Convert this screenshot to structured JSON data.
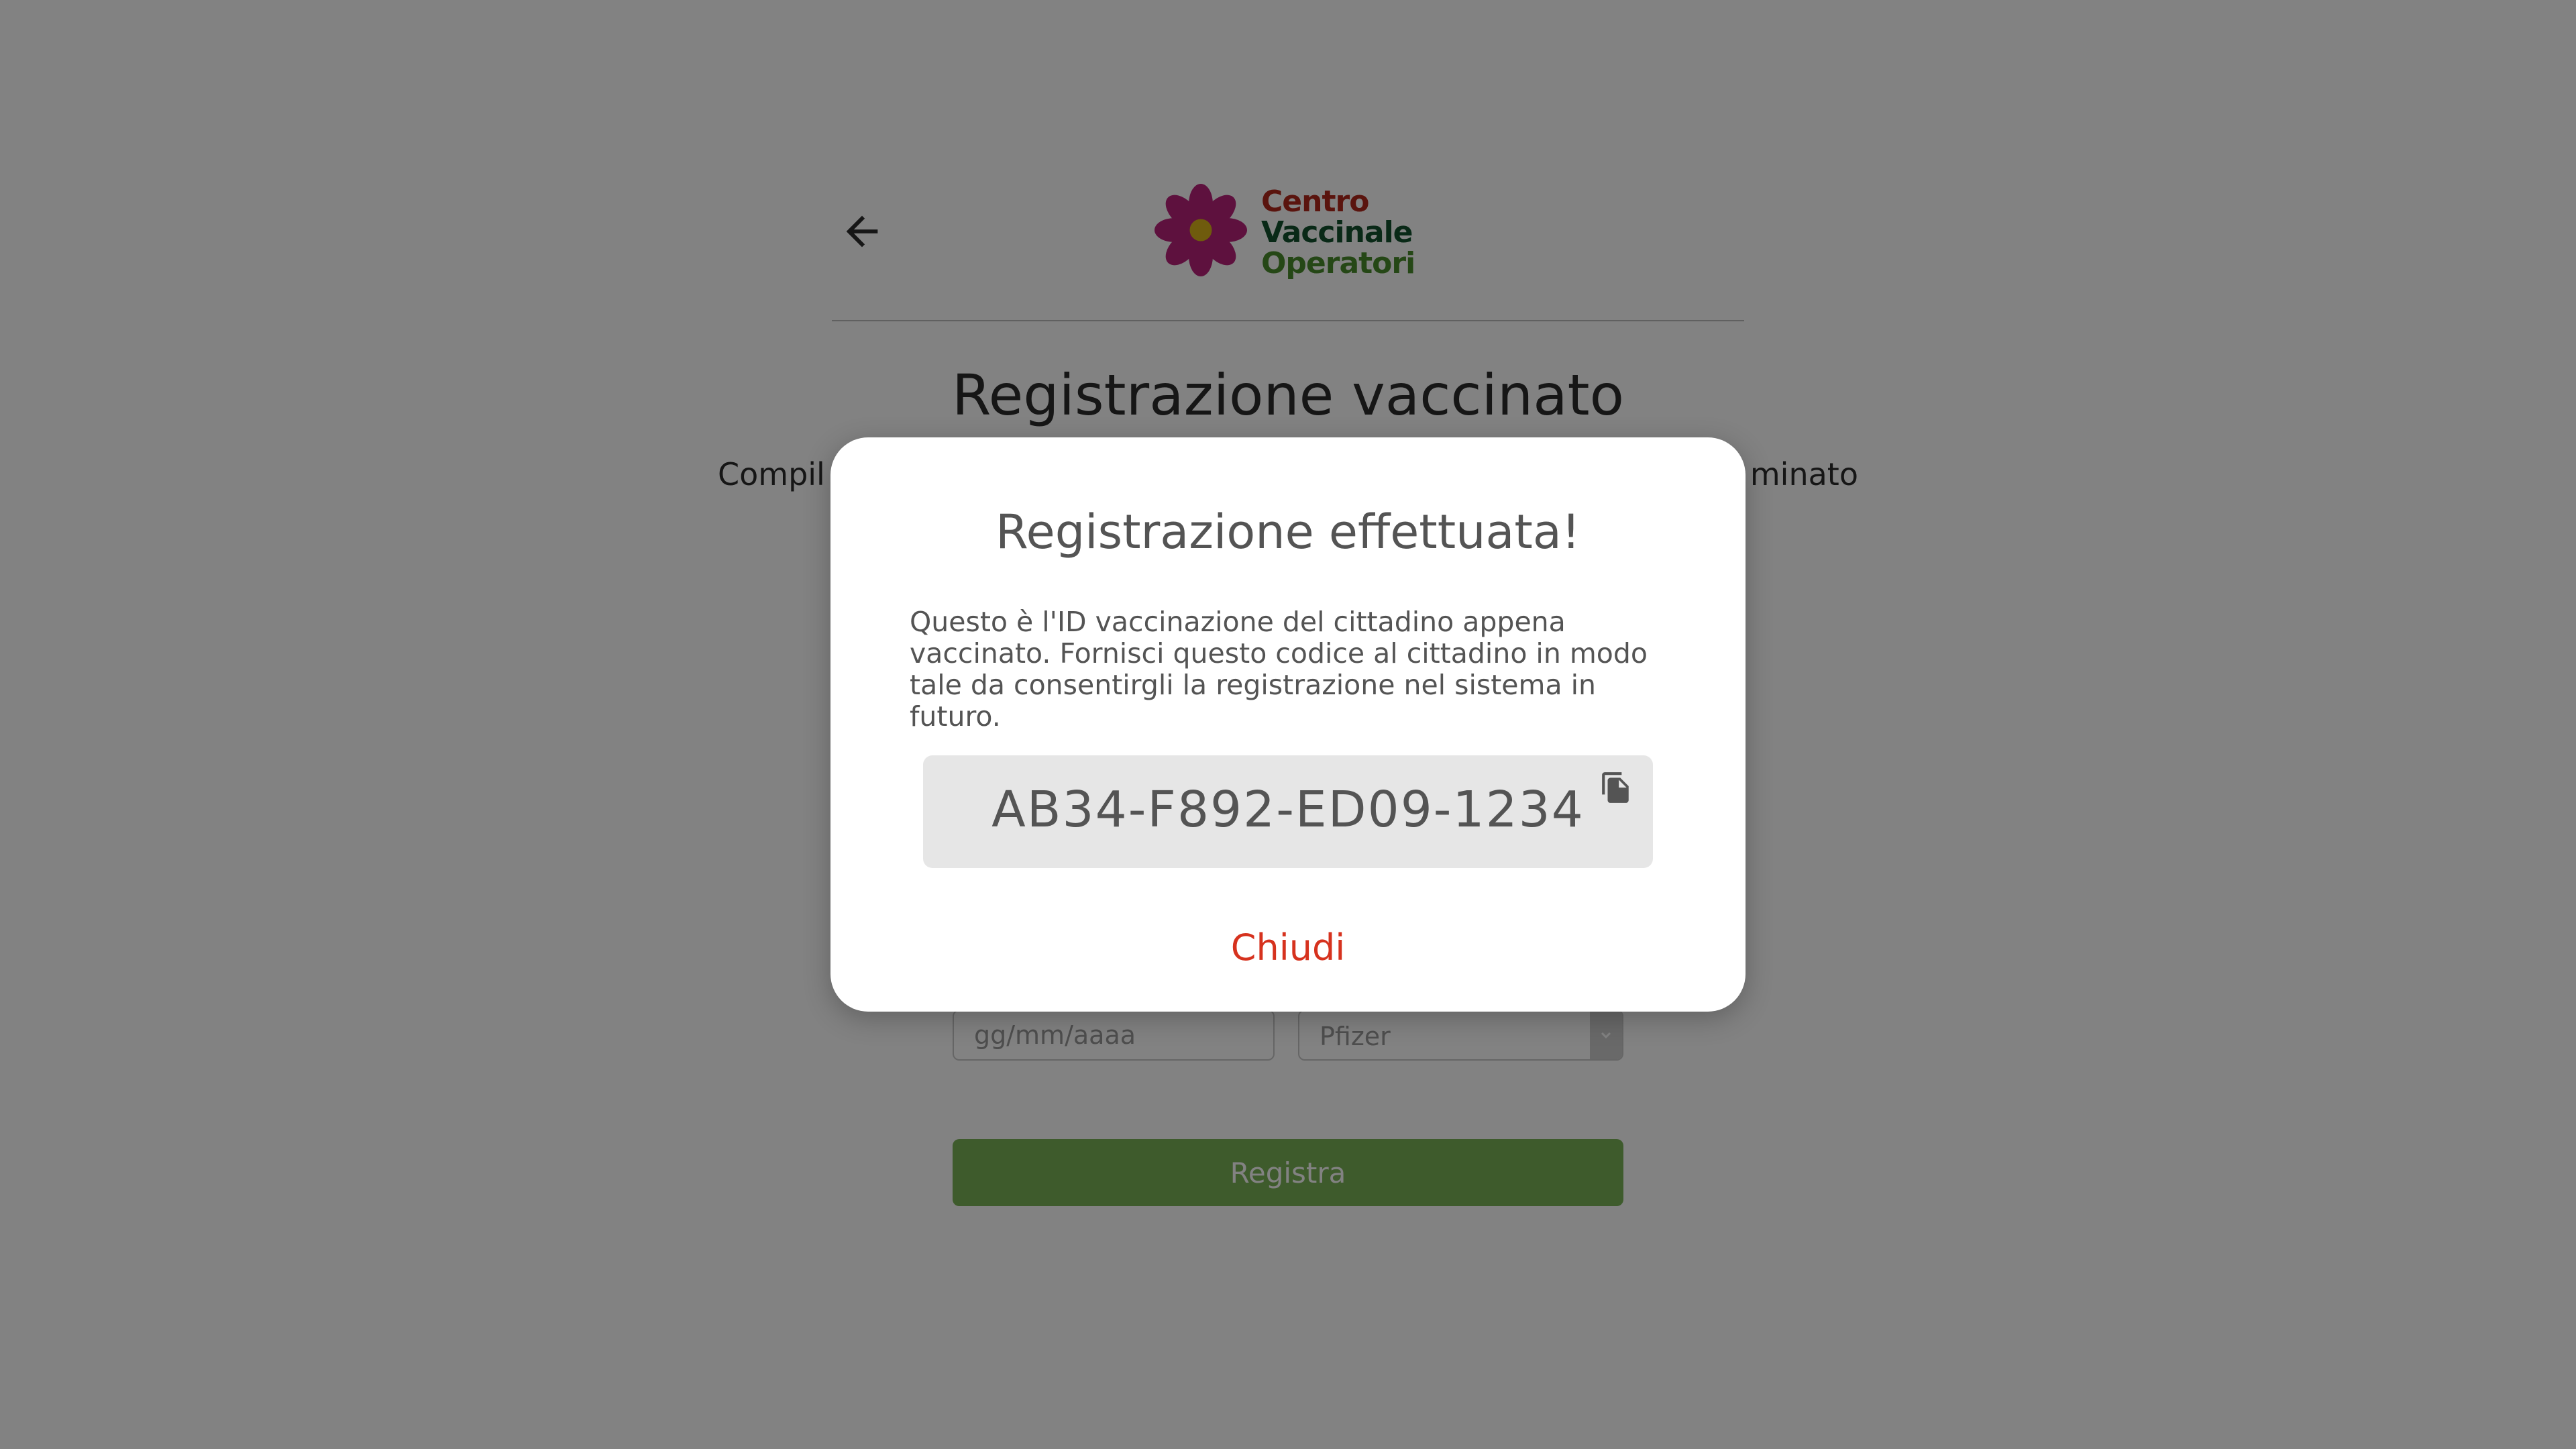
{
  "header": {
    "back_icon": "arrow-left-icon",
    "logo": {
      "line1": "Centro",
      "line2": "Vaccinale",
      "line3": "Operatori",
      "colors": {
        "line1": "#b0281c",
        "line2": "#13522d",
        "line3": "#4a8b2c",
        "petals": "#b8237a",
        "center": "#d9b21b"
      }
    }
  },
  "page": {
    "title": "Registrazione vaccinato",
    "subtitle_left": "Compil",
    "subtitle_right": "minato"
  },
  "form": {
    "date_placeholder": "gg/mm/aaaa",
    "vaccine_value": "Pfizer",
    "register_label": "Registra",
    "accent_color": "#7ab356"
  },
  "modal": {
    "title": "Registrazione effettuata!",
    "text": "Questo è l'ID vaccinazione del cittadino appena vaccinato. Fornisci questo codice al cittadino in modo tale da consentirgli la registrazione nel sistema in futuro.",
    "code": "AB34-F892-ED09-1234",
    "copy_icon": "copy-icon",
    "close_label": "Chiudi",
    "close_color": "#d6321e"
  }
}
